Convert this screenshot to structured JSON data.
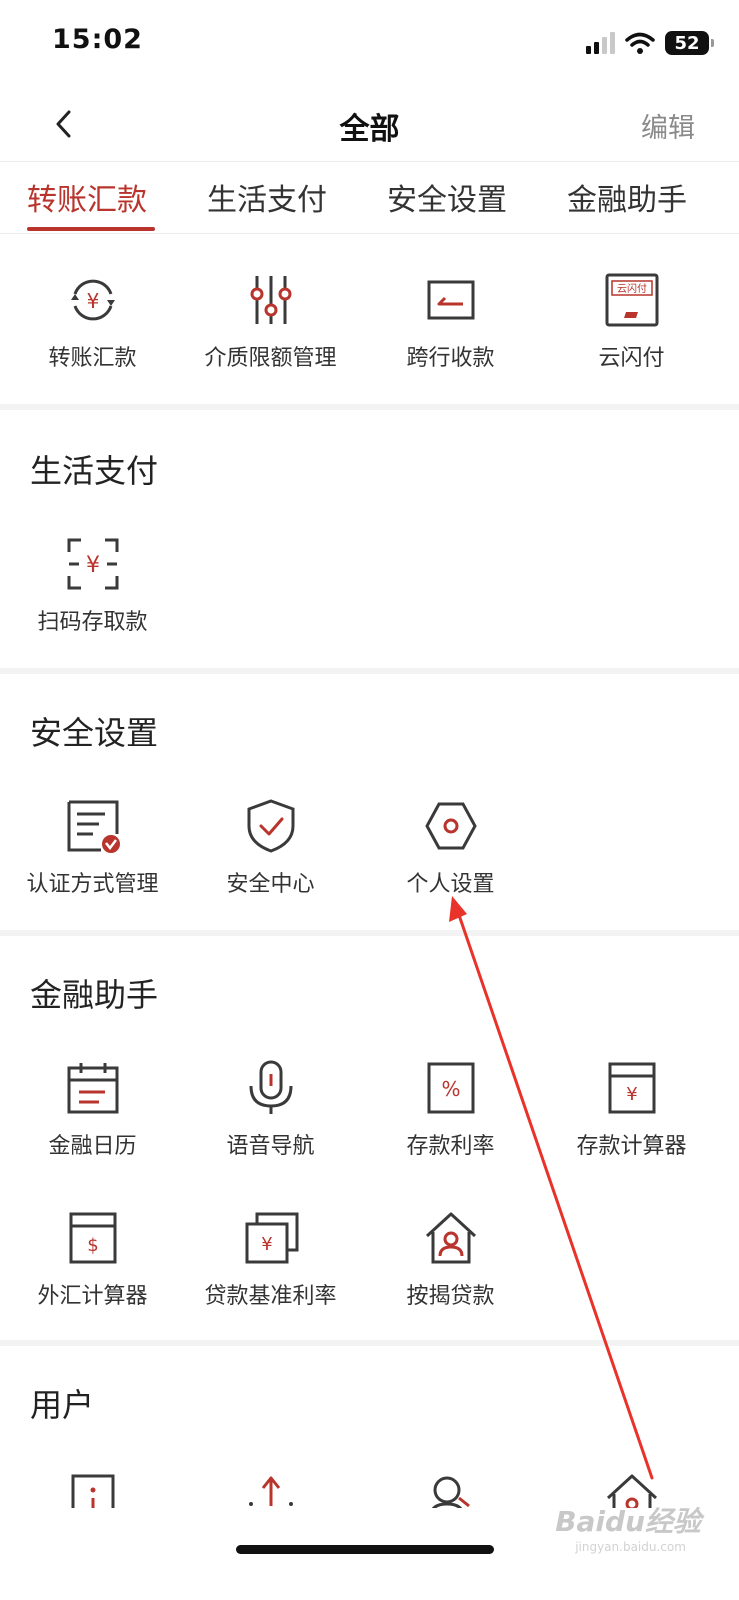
{
  "status_bar": {
    "time": "15:02",
    "battery": "52"
  },
  "nav": {
    "title": "全部",
    "edit_label": "编辑"
  },
  "tabs": [
    {
      "label": "转账汇款",
      "active": true
    },
    {
      "label": "生活支付",
      "active": false
    },
    {
      "label": "安全设置",
      "active": false
    },
    {
      "label": "金融助手",
      "active": false
    }
  ],
  "transfer_section": {
    "items": [
      {
        "label": "转账汇款",
        "icon": "transfer-icon"
      },
      {
        "label": "介质限额管理",
        "icon": "sliders-icon"
      },
      {
        "label": "跨行收款",
        "icon": "interbank-receive-icon"
      },
      {
        "label": "云闪付",
        "icon": "cloud-quickpass-icon",
        "icon_text": "云闪付"
      }
    ]
  },
  "life_section": {
    "title": "生活支付",
    "items": [
      {
        "label": "扫码存取款",
        "icon": "scan-yuan-icon"
      }
    ]
  },
  "security_section": {
    "title": "安全设置",
    "items": [
      {
        "label": "认证方式管理",
        "icon": "auth-doc-icon"
      },
      {
        "label": "安全中心",
        "icon": "shield-check-icon"
      },
      {
        "label": "个人设置",
        "icon": "hexagon-settings-icon"
      }
    ]
  },
  "finance_section": {
    "title": "金融助手",
    "items": [
      {
        "label": "金融日历",
        "icon": "calendar-icon"
      },
      {
        "label": "语音导航",
        "icon": "microphone-icon"
      },
      {
        "label": "存款利率",
        "icon": "percent-doc-icon"
      },
      {
        "label": "存款计算器",
        "icon": "deposit-calculator-icon"
      },
      {
        "label": "外汇计算器",
        "icon": "forex-calculator-icon"
      },
      {
        "label": "贷款基准利率",
        "icon": "loan-rate-icon"
      },
      {
        "label": "按揭贷款",
        "icon": "mortgage-house-icon"
      }
    ]
  },
  "user_section": {
    "title": "用户",
    "items": [
      {
        "icon": "info-doc-icon"
      },
      {
        "icon": "upload-arrow-icon"
      },
      {
        "icon": "user-search-icon"
      },
      {
        "icon": "home-icon"
      }
    ]
  },
  "watermark": {
    "text": "Baidu经验",
    "sub": "jingyan.baidu.com"
  },
  "colors": {
    "accent": "#b8342c",
    "icon_stroke": "#3a3a3a",
    "annotation_arrow": "#e8322a"
  }
}
